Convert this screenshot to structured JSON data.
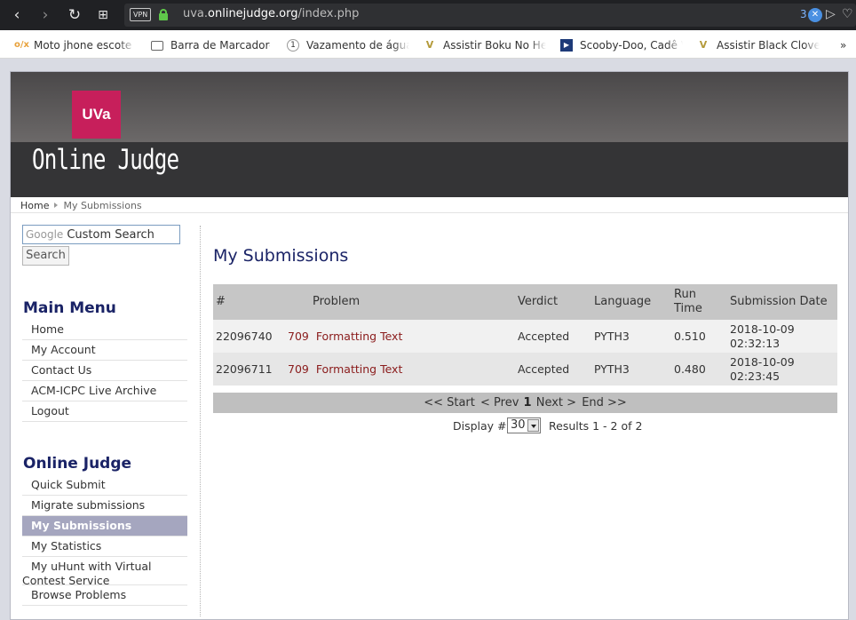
{
  "browser": {
    "url_prefix": "uva.",
    "url_domain": "onlinejudge.org",
    "url_path": "/index.php",
    "vpn_label": "VPN",
    "ext_count": "3",
    "bookmarks": [
      {
        "icon": "olx-icon",
        "label": "Moto jhone escote ar"
      },
      {
        "icon": "folder-icon",
        "label": "Barra de Marcadores"
      },
      {
        "icon": "bookmark-1-icon",
        "label": "Vazamento de água c"
      },
      {
        "icon": "v-logo-icon",
        "label": "Assistir Boku No Her"
      },
      {
        "icon": "video-icon",
        "label": "Scooby-Doo, Cadê Vo"
      },
      {
        "icon": "v-logo-icon",
        "label": "Assistir Black Clover -"
      }
    ],
    "bookmarks_more": "»"
  },
  "site": {
    "logo": "UVa",
    "title": "Online Judge"
  },
  "breadcrumb": {
    "home": "Home",
    "current": "My Submissions"
  },
  "search": {
    "google_label": "Google",
    "placeholder": "Custom Search",
    "button": "Search"
  },
  "main_menu": {
    "title": "Main Menu",
    "items": [
      "Home",
      "My Account",
      "Contact Us",
      "ACM-ICPC Live Archive",
      "Logout"
    ]
  },
  "judge_menu": {
    "title": "Online Judge",
    "items": [
      "Quick Submit",
      "Migrate submissions",
      "My Submissions",
      "My Statistics"
    ],
    "uhunt_line1": "My uHunt with Virtual",
    "uhunt_line2": "Contest Service",
    "browse": "Browse Problems"
  },
  "content": {
    "title": "My Submissions",
    "columns": {
      "id": "#",
      "problem": "Problem",
      "verdict": "Verdict",
      "language": "Language",
      "runtime_1": "Run",
      "runtime_2": "Time",
      "date": "Submission Date"
    },
    "rows": [
      {
        "id": "22096740",
        "problem_num": "709",
        "problem_name": "Formatting Text",
        "verdict": "Accepted",
        "language": "PYTH3",
        "runtime": "0.510",
        "date": "2018-10-09",
        "time": "02:32:13"
      },
      {
        "id": "22096711",
        "problem_num": "709",
        "problem_name": "Formatting Text",
        "verdict": "Accepted",
        "language": "PYTH3",
        "runtime": "0.480",
        "date": "2018-10-09",
        "time": "02:23:45"
      }
    ],
    "pager": {
      "start": "<< Start",
      "prev": "< Prev",
      "page": "1",
      "next": "Next >",
      "end": "End >>"
    },
    "display_label": "Display #",
    "display_value": "30",
    "results": "Results 1 - 2 of 2"
  }
}
